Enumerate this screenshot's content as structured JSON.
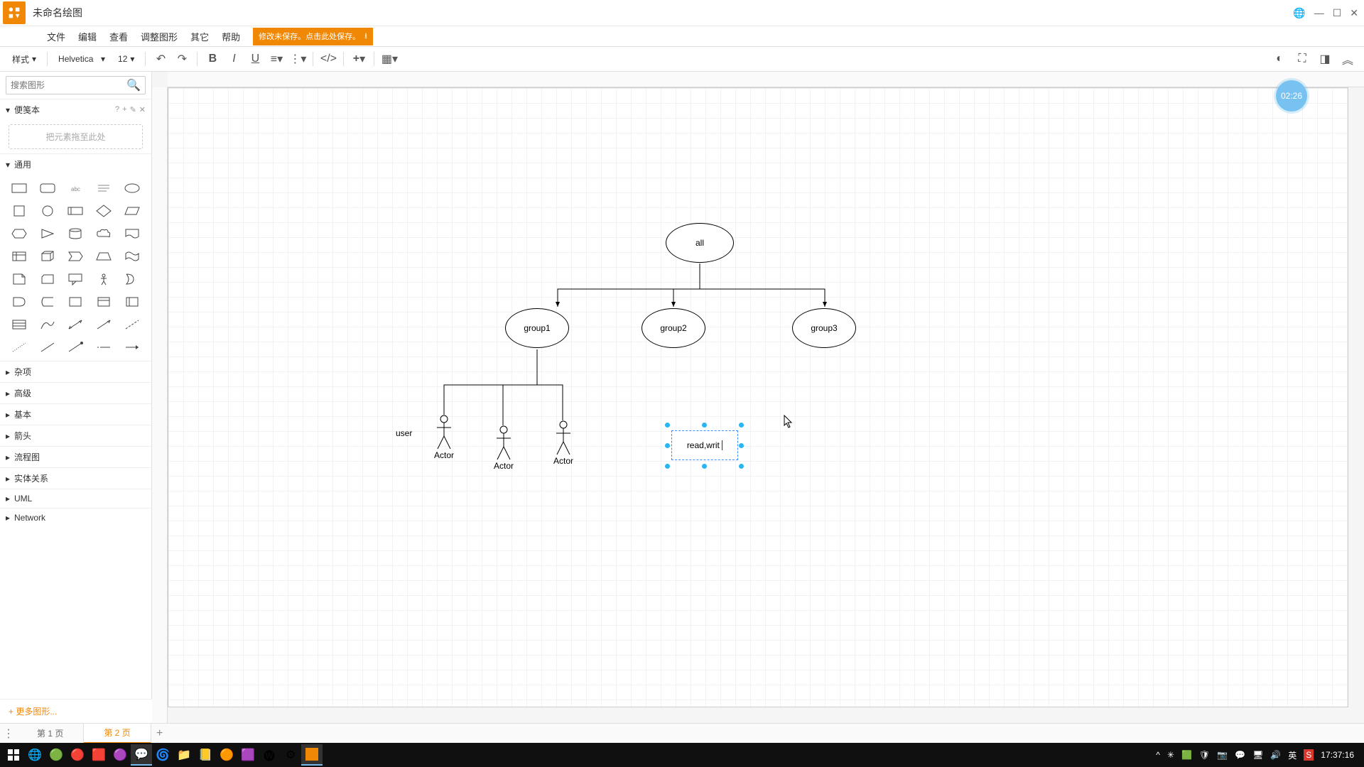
{
  "title": "未命名绘图",
  "menubar": [
    "文件",
    "编辑",
    "查看",
    "调整图形",
    "其它",
    "帮助"
  ],
  "unsaved_warning": "修改未保存。点击此处保存。",
  "toolbar": {
    "style": "样式",
    "font": "Helvetica",
    "fontsize": "12"
  },
  "sidebar": {
    "search_placeholder": "搜索图形",
    "scratchpad_title": "便笺本",
    "scratch_hint": "把元素拖至此处",
    "categories": [
      "通用",
      "杂项",
      "高级",
      "基本",
      "箭头",
      "流程图",
      "实体关系",
      "UML",
      "Network"
    ],
    "more_shapes": "+ 更多图形..."
  },
  "diagram": {
    "all": "all",
    "group1": "group1",
    "group2": "group2",
    "group3": "group3",
    "user": "user",
    "actor": "Actor",
    "editing_text": "read,writ"
  },
  "timer": "02:26",
  "pages": {
    "p1": "第 1 页",
    "p2": "第 2 页"
  },
  "taskbar": {
    "ime": "英",
    "clock": "17:37:16"
  }
}
